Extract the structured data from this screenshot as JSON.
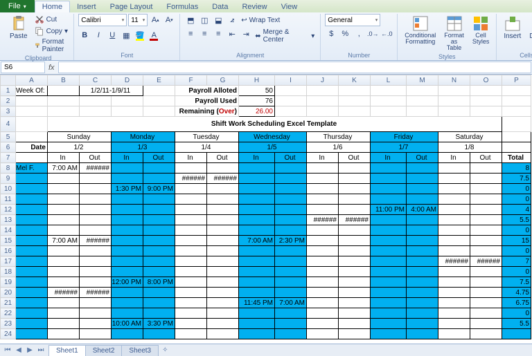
{
  "file_menu": "File",
  "ribbon_tabs": [
    "Home",
    "Insert",
    "Page Layout",
    "Formulas",
    "Data",
    "Review",
    "View"
  ],
  "active_ribbon_tab": 0,
  "clipboard": {
    "paste": "Paste",
    "cut": "Cut",
    "copy": "Copy",
    "painter": "Format Painter",
    "group": "Clipboard"
  },
  "font": {
    "name": "Calibri",
    "size": "11",
    "group": "Font"
  },
  "alignment": {
    "wrap": "Wrap Text",
    "merge": "Merge & Center",
    "group": "Alignment"
  },
  "number": {
    "format": "General",
    "group": "Number"
  },
  "styles": {
    "cond": "Conditional Formatting",
    "table": "Format as Table",
    "cell": "Cell Styles",
    "group": "Styles"
  },
  "cells": {
    "insert": "Insert",
    "delete": "Delete",
    "group": "Cells"
  },
  "namebox": "S6",
  "columns": [
    "A",
    "B",
    "C",
    "D",
    "E",
    "F",
    "G",
    "H",
    "I",
    "J",
    "K",
    "L",
    "M",
    "N",
    "O",
    "P"
  ],
  "row_labels": [
    1,
    2,
    3,
    4,
    5,
    6,
    7,
    8,
    9,
    10,
    11,
    12,
    13,
    14,
    15,
    16,
    17,
    18,
    19,
    20,
    21,
    22,
    23,
    24
  ],
  "sheet_tabs": [
    "Sheet1",
    "Sheet2",
    "Sheet3"
  ],
  "active_sheet": 0,
  "content": {
    "week_of_label": "Week Of:",
    "week_of_value": "1/2/11-1/9/11",
    "payroll_alloted_label": "Payroll Alloted",
    "payroll_alloted_value": "50",
    "payroll_used_label": "Payroll Used",
    "payroll_used_value": "76",
    "remaining_label_a": "Remaining (",
    "remaining_label_b": "Over",
    "remaining_label_c": ")",
    "remaining_value": "26.00",
    "title": "Shift Work Scheduling Excel Template",
    "date_label": "Date",
    "in_label": "In",
    "out_label": "Out",
    "total_label": "Total",
    "days": [
      "Sunday",
      "Monday",
      "Tuesday",
      "Wednesday",
      "Thursday",
      "Friday",
      "Saturday"
    ],
    "dates": [
      "1/2",
      "1/3",
      "1/4",
      "1/5",
      "1/6",
      "1/7",
      "1/8"
    ],
    "employee": "Mel F.",
    "hash": "######",
    "r8": {
      "b": "7:00 AM",
      "c": "######",
      "p": "8"
    },
    "r9": {
      "f": "######",
      "g": "######",
      "p": "7.5"
    },
    "r10": {
      "d": "1:30 PM",
      "e": "9:00 PM",
      "p": "0"
    },
    "r11": {
      "p": "0"
    },
    "r12": {
      "l": "11:00 PM",
      "m": "4:00 AM",
      "p": "4"
    },
    "r13": {
      "j": "######",
      "k": "######",
      "p": "5.5"
    },
    "r14": {
      "p": "0"
    },
    "r15": {
      "b": "7:00 AM",
      "c": "######",
      "h": "7:00 AM",
      "i": "2:30 PM",
      "p": "15"
    },
    "r16": {
      "p": "0"
    },
    "r17": {
      "n": "######",
      "o": "######",
      "p": "7"
    },
    "r18": {
      "p": "0"
    },
    "r19": {
      "d": "12:00 PM",
      "e": "8:00 PM",
      "p": "7.5"
    },
    "r20": {
      "b": "######",
      "c": "######",
      "p": "4.75"
    },
    "r21": {
      "h": "11:45 PM",
      "i": "7:00 AM",
      "p": "6.75"
    },
    "r22": {
      "p": "0"
    },
    "r23": {
      "d": "10:00 AM",
      "e": "3:30 PM",
      "p": "5.5"
    }
  }
}
